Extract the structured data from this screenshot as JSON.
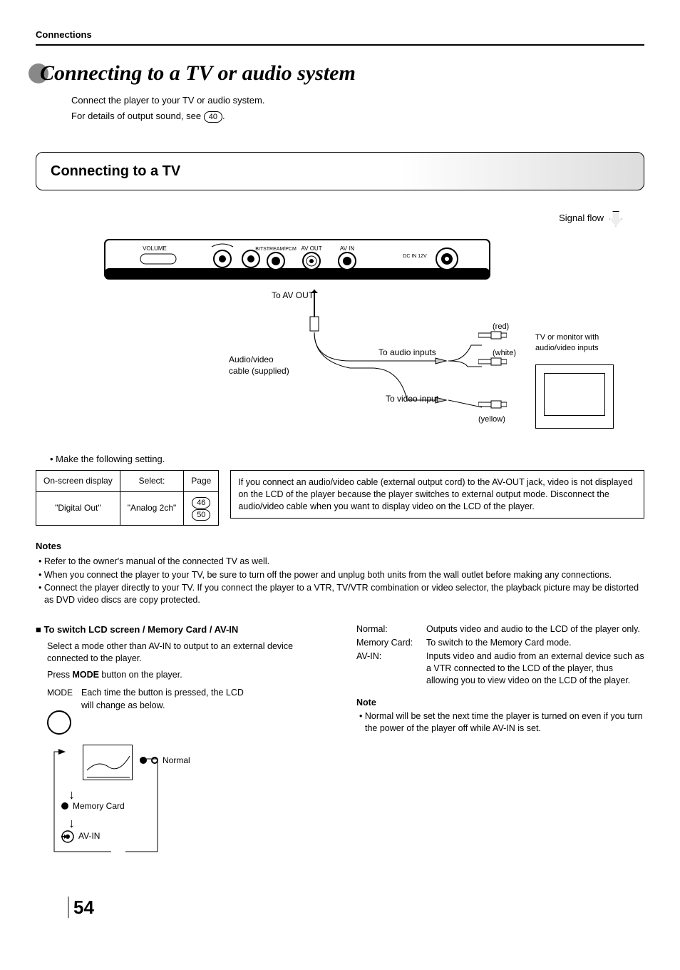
{
  "header": {
    "section": "Connections"
  },
  "title": "Connecting to a TV or audio system",
  "intro": {
    "line1": "Connect the player to your TV or audio system.",
    "line2_prefix": "For details of output sound, see ",
    "line2_ref": "40",
    "line2_suffix": "."
  },
  "section1": {
    "title": "Connecting to a TV"
  },
  "diagram": {
    "signal_flow": "Signal flow",
    "device_labels": {
      "volume": "VOLUME",
      "bitstream": "BITSTREAM/PCM",
      "avout": "AV OUT",
      "avin": "AV IN",
      "dcin": "DC IN 12V"
    },
    "to_av_out": "To AV OUT",
    "cable": "Audio/video\ncable (supplied)",
    "to_audio": "To audio inputs",
    "to_video": "To video input",
    "red": "(red)",
    "white": "(white)",
    "yellow": "(yellow)",
    "tv_desc": "TV or monitor with audio/video inputs"
  },
  "setting_note": "Make the following setting.",
  "settings_table": {
    "headers": {
      "c1": "On-screen display",
      "c2": "Select:",
      "c3": "Page"
    },
    "row": {
      "c1": "\"Digital Out\"",
      "c2": "\"Analog 2ch\"",
      "c3a": "46",
      "c3b": "50"
    }
  },
  "info_box": "If you connect an audio/video cable (external output cord) to the AV-OUT jack, video is not displayed on the LCD of the player because the player switches to external output mode. Disconnect the audio/video cable when you want to display video on the LCD of the player.",
  "notes": {
    "heading": "Notes",
    "items": [
      "Refer to the owner's manual of the connected TV as well.",
      "When you connect the player to your TV, be sure to turn off the power and unplug both units from the wall outlet before making any connections.",
      "Connect the player directly to your TV.  If you connect the player to a VTR, TV/VTR combination or video selector, the playback picture may be distorted as DVD video discs are copy protected."
    ]
  },
  "subsection": {
    "heading": "To switch LCD screen / Memory Card / AV-IN",
    "body1": "Select a mode other than AV-IN to output to an external device connected to the player.",
    "body2_prefix": "Press ",
    "body2_bold": "MODE",
    "body2_suffix": " button on the player.",
    "mode_label": "MODE",
    "mode_desc": "Each time the button is pressed, the LCD will change as below.",
    "cycle": {
      "normal": "Normal",
      "memory": "Memory Card",
      "avin": "AV-IN"
    }
  },
  "definitions": [
    {
      "term": "Normal:",
      "desc": "Outputs video and audio to the LCD of the player only."
    },
    {
      "term": "Memory Card:",
      "desc": "To switch to the Memory Card mode."
    },
    {
      "term": "AV-IN:",
      "desc": "Inputs video and audio from an external device such as a VTR connected to the LCD of the player, thus allowing you to view video on the LCD of the player."
    }
  ],
  "note2": {
    "heading": "Note",
    "text": "Normal will be set the next time the player is turned on even if you turn the power of the player off while AV-IN is set."
  },
  "page_number": "54"
}
